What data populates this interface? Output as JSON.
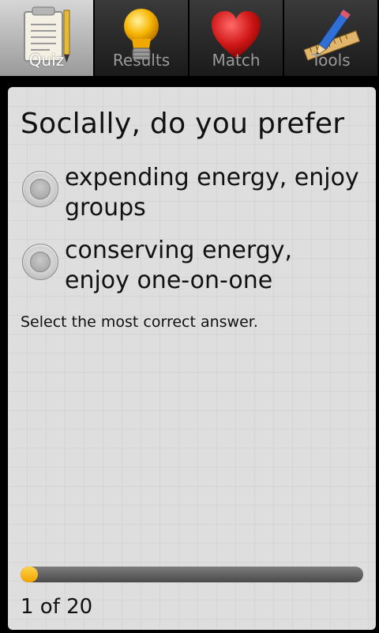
{
  "tabs": [
    {
      "label": "Quiz",
      "icon": "notepad-icon",
      "selected": true
    },
    {
      "label": "Results",
      "icon": "lightbulb-icon",
      "selected": false
    },
    {
      "label": "Match",
      "icon": "heart-icon",
      "selected": false
    },
    {
      "label": "Tools",
      "icon": "ruler-pencil-icon",
      "selected": false
    }
  ],
  "quiz": {
    "question": "Soclally, do you prefer",
    "options": [
      {
        "label": "expending energy, enjoy groups",
        "selected": false
      },
      {
        "label": "conserving energy, enjoy one-on-one",
        "selected": false
      }
    ],
    "hint": "Select the most correct answer.",
    "progress": {
      "current": 1,
      "total": 20,
      "text": "1 of 20",
      "fraction": 0.05
    }
  },
  "colors": {
    "progress_fill": "#f0a400",
    "progress_track": "#4a4a4a",
    "card_background": "#dedede",
    "selected_tab": "#c4c4c4"
  }
}
